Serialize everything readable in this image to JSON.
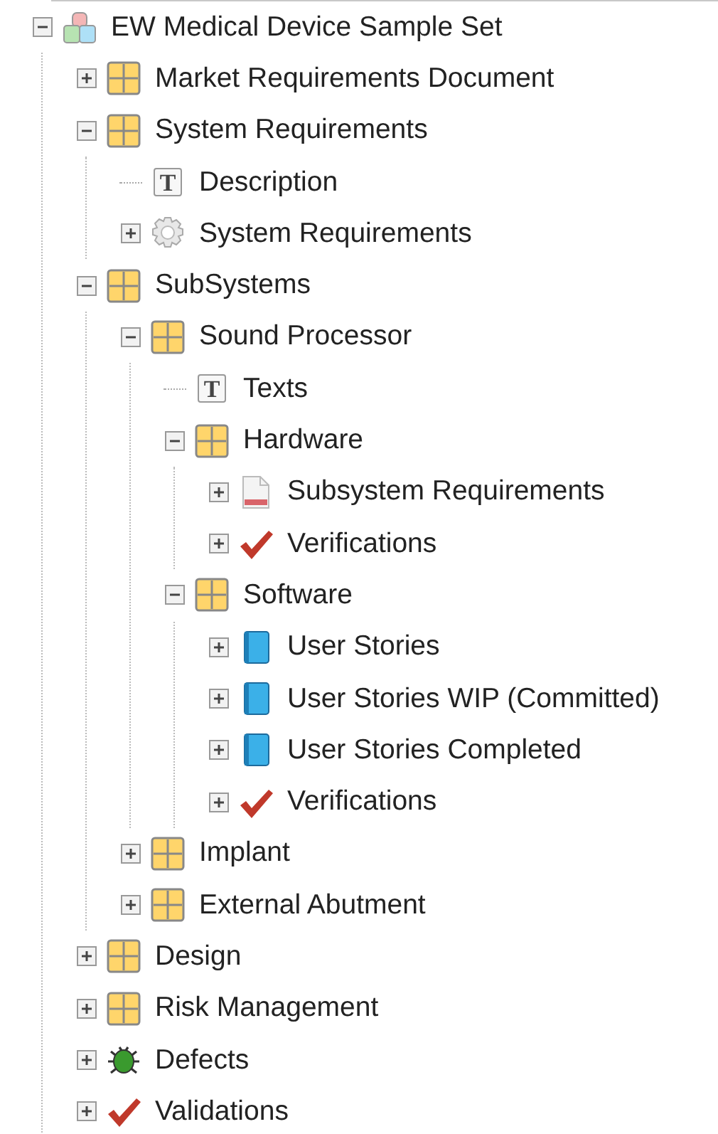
{
  "tree": [
    {
      "label": "EW Medical Device Sample Set",
      "kind": "project",
      "expanded": true,
      "children": [
        {
          "label": "Market Requirements Document",
          "kind": "folder",
          "expanded": false
        },
        {
          "label": "System Requirements",
          "kind": "folder",
          "expanded": true,
          "children": [
            {
              "label": "Description",
              "kind": "text",
              "glyph": "T"
            },
            {
              "label": "System Requirements",
              "kind": "gear",
              "expanded": false
            }
          ]
        },
        {
          "label": "SubSystems",
          "kind": "folder",
          "expanded": true,
          "children": [
            {
              "label": "Sound Processor",
              "kind": "folder",
              "expanded": true,
              "children": [
                {
                  "label": "Texts",
                  "kind": "text",
                  "glyph": "T"
                },
                {
                  "label": "Hardware",
                  "kind": "folder",
                  "expanded": true,
                  "children": [
                    {
                      "label": "Subsystem Requirements",
                      "kind": "document",
                      "expanded": false
                    },
                    {
                      "label": "Verifications",
                      "kind": "check",
                      "expanded": false
                    }
                  ]
                },
                {
                  "label": "Software",
                  "kind": "folder",
                  "expanded": true,
                  "children": [
                    {
                      "label": "User Stories",
                      "kind": "book",
                      "expanded": false
                    },
                    {
                      "label": "User Stories WIP (Committed)",
                      "kind": "book",
                      "expanded": false
                    },
                    {
                      "label": "User Stories Completed",
                      "kind": "book",
                      "expanded": false
                    },
                    {
                      "label": "Verifications",
                      "kind": "check",
                      "expanded": false
                    }
                  ]
                }
              ]
            },
            {
              "label": "Implant",
              "kind": "folder",
              "expanded": false
            },
            {
              "label": "External Abutment",
              "kind": "folder",
              "expanded": false
            }
          ]
        },
        {
          "label": "Design",
          "kind": "folder",
          "expanded": false
        },
        {
          "label": "Risk Management",
          "kind": "folder",
          "expanded": false
        },
        {
          "label": "Defects",
          "kind": "bug",
          "expanded": false
        },
        {
          "label": "Validations",
          "kind": "check",
          "expanded": false
        }
      ]
    }
  ]
}
